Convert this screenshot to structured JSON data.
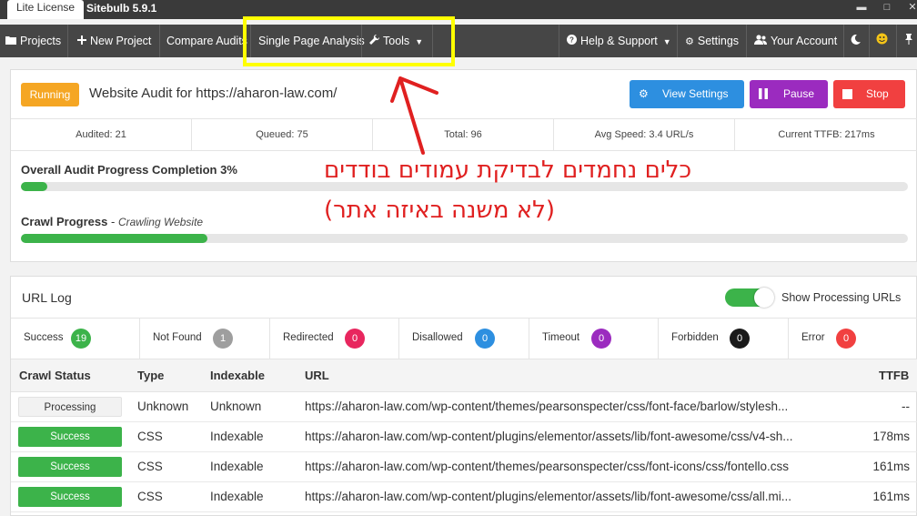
{
  "titlebar": {
    "license": "Lite License",
    "app_name": "Sitebulb 5.9.1",
    "minimize": "▬",
    "maximize": "□",
    "close": "✕"
  },
  "toolbar": {
    "projects": "Projects",
    "new_project": "New Project",
    "compare_audits": "Compare Audits",
    "single_page_analysis": "Single Page Analysis",
    "tools": "Tools",
    "help_support": "Help & Support",
    "settings": "Settings",
    "your_account": "Your Account",
    "icons": {
      "projects": "folder-icon",
      "new_project": "plus-icon",
      "tools": "wrench-icon",
      "help": "question-icon",
      "settings": "gears-icon",
      "account": "users-icon",
      "theme": "moon-icon",
      "emoji": "smiley-icon",
      "pin": "pin-icon"
    }
  },
  "audit": {
    "status_badge": "Running",
    "title": "Website Audit for https://aharon-law.com/",
    "buttons": {
      "view_settings": "View Settings",
      "pause": "Pause",
      "stop": "Stop"
    },
    "stats": {
      "audited": "Audited: 21",
      "queued": "Queued: 75",
      "total": "Total: 96",
      "avg_speed": "Avg Speed: 3.4 URL/s",
      "current_ttfb": "Current TTFB:  217ms"
    },
    "overall_progress": {
      "label": "Overall Audit Progress Completion 3%",
      "value": 0.03
    },
    "crawl_progress": {
      "label": "Crawl Progress",
      "sublabel": "Crawling Website",
      "value": 0.21
    }
  },
  "annotation": {
    "line1": "כלים נחמדים לבדיקת עמודים בודדים",
    "line2": "(לא משנה באיזה אתר)",
    "highlight_color": "#ffff00",
    "text_color": "#e02020"
  },
  "url_log": {
    "title": "URL Log",
    "toggle_label": "Show Processing URLs",
    "toggle_on": true,
    "filters": [
      {
        "label": "Success",
        "count": "19",
        "color": "#3cb34a"
      },
      {
        "label": "Not Found",
        "count": "1",
        "color": "#9e9e9e"
      },
      {
        "label": "Redirected",
        "count": "0",
        "color": "#e8265e"
      },
      {
        "label": "Disallowed",
        "count": "0",
        "color": "#2d8fe0"
      },
      {
        "label": "Timeout",
        "count": "0",
        "color": "#9b2bbf"
      },
      {
        "label": "Forbidden",
        "count": "0",
        "color": "#1a1a1a"
      },
      {
        "label": "Error",
        "count": "0",
        "color": "#f14040"
      }
    ],
    "columns": {
      "crawl_status": "Crawl Status",
      "type": "Type",
      "indexable": "Indexable",
      "url": "URL",
      "ttfb": "TTFB"
    },
    "rows": [
      {
        "status": "Processing",
        "type": "Unknown",
        "indexable": "Unknown",
        "url": "https://aharon-law.com/wp-content/themes/pearsonspecter/css/font-face/barlow/stylesh...",
        "ttfb": "--"
      },
      {
        "status": "Success",
        "type": "CSS",
        "indexable": "Indexable",
        "url": "https://aharon-law.com/wp-content/plugins/elementor/assets/lib/font-awesome/css/v4-sh...",
        "ttfb": "178ms"
      },
      {
        "status": "Success",
        "type": "CSS",
        "indexable": "Indexable",
        "url": "https://aharon-law.com/wp-content/themes/pearsonspecter/css/font-icons/css/fontello.css",
        "ttfb": "161ms"
      },
      {
        "status": "Success",
        "type": "CSS",
        "indexable": "Indexable",
        "url": "https://aharon-law.com/wp-content/plugins/elementor/assets/lib/font-awesome/css/all.mi...",
        "ttfb": "161ms"
      }
    ]
  }
}
